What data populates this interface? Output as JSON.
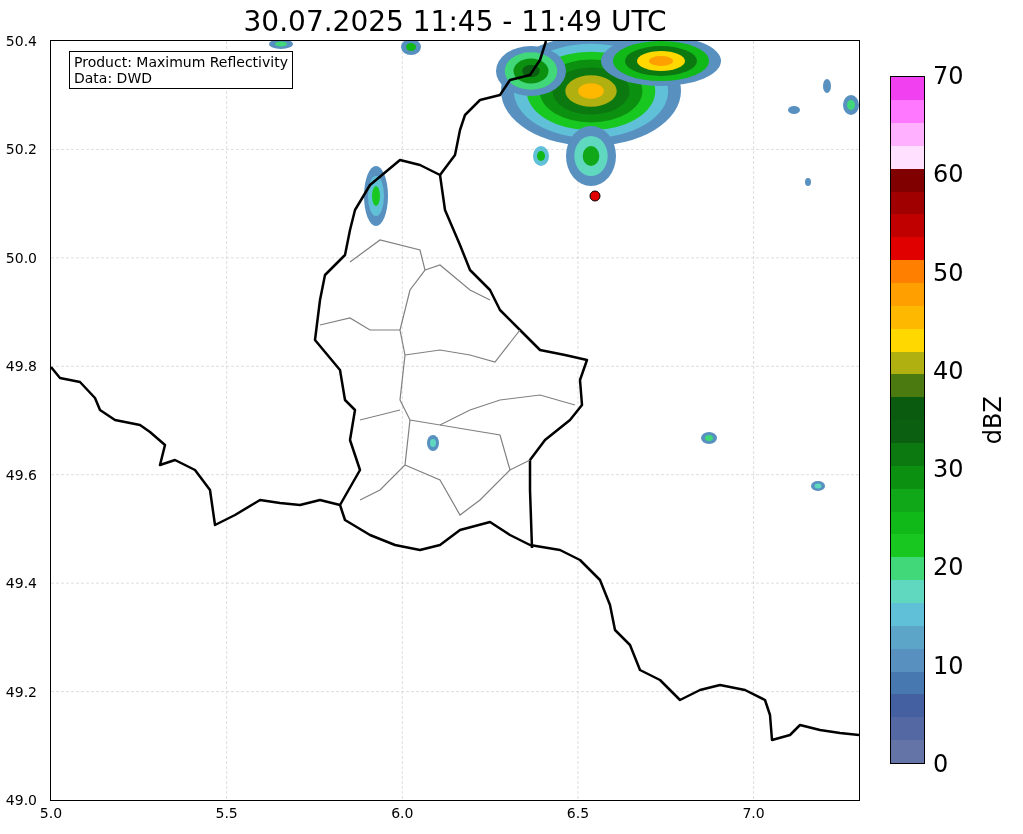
{
  "title": "30.07.2025 11:45 - 11:49 UTC",
  "map": {
    "info_box": [
      "Product: Maximum Reflectivity",
      "Data: DWD"
    ],
    "x_ticks": [
      "5.0",
      "5.5",
      "6.0",
      "6.5",
      "7.0"
    ],
    "y_ticks": [
      "50.4",
      "50.2",
      "50.0",
      "49.8",
      "49.6",
      "49.4",
      "49.2",
      "49.0"
    ]
  },
  "colorbar": {
    "label": "dBZ",
    "ticks": [
      "70",
      "60",
      "50",
      "40",
      "30",
      "20",
      "10",
      "0"
    ],
    "bins": [
      {
        "color": "#6474a6"
      },
      {
        "color": "#5468a4"
      },
      {
        "color": "#4560a0"
      },
      {
        "color": "#4878b0"
      },
      {
        "color": "#5890c0"
      },
      {
        "color": "#5ca4c8"
      },
      {
        "color": "#60c0d8"
      },
      {
        "color": "#60d8c0"
      },
      {
        "color": "#40d878"
      },
      {
        "color": "#18c820"
      },
      {
        "color": "#10b818"
      },
      {
        "color": "#10a818"
      },
      {
        "color": "#0c9010"
      },
      {
        "color": "#0c7810"
      },
      {
        "color": "#0a6010"
      },
      {
        "color": "#0a5a10"
      },
      {
        "color": "#4a7a10"
      },
      {
        "color": "#b0b010"
      },
      {
        "color": "#ffd800"
      },
      {
        "color": "#ffb800"
      },
      {
        "color": "#ff9f00"
      },
      {
        "color": "#ff8000"
      },
      {
        "color": "#e00000"
      },
      {
        "color": "#c00000"
      },
      {
        "color": "#a00000"
      },
      {
        "color": "#800000"
      },
      {
        "color": "#ffe0ff"
      },
      {
        "color": "#ffb0ff"
      },
      {
        "color": "#ff78ff"
      },
      {
        "color": "#f040f0"
      }
    ]
  }
}
